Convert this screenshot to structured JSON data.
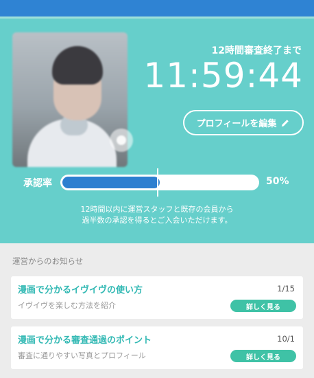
{
  "header": {
    "color": "#2f83d3"
  },
  "hero": {
    "background": "#66cfcb",
    "avatar_icon": "profile-photo",
    "camera_icon": "camera-icon",
    "countdown_label": "12時間審査終了まで",
    "countdown": "11:59:44",
    "edit_profile_label": "プロフィールを編集",
    "edit_icon": "pencil-icon"
  },
  "approval": {
    "label": "承認率",
    "percent_text": "50%",
    "progress": 0.5,
    "note_line1": "12時間以内に運営スタッフと既存の会員から",
    "note_line2": "過半数の承認を得るとご入会いただけます。"
  },
  "news": {
    "section_title": "運営からのお知らせ",
    "items": [
      {
        "title": "漫画で分かるイヴイヴの使い方",
        "subtitle": "イヴイヴを楽しむ方法を紹介",
        "date": "1/15",
        "button": "詳しく見る"
      },
      {
        "title": "漫画で分かる審査通過のポイント",
        "subtitle": "審査に通りやすい写真とプロフィール",
        "date": "10/1",
        "button": "詳しく見る"
      }
    ]
  },
  "colors": {
    "accent": "#33b9b4",
    "button": "#3fc2a6",
    "progress": "#2d7fd0"
  }
}
